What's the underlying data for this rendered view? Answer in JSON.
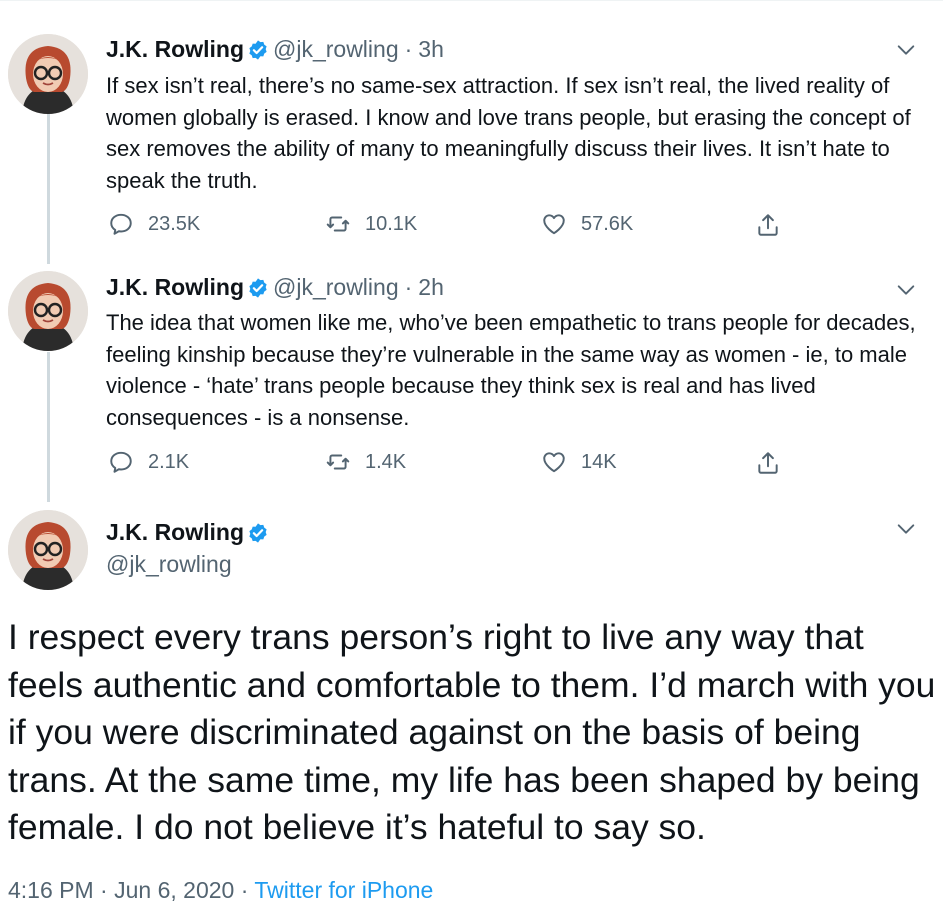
{
  "author": {
    "name": "J.K. Rowling",
    "handle": "@jk_rowling",
    "verified": true
  },
  "colors": {
    "accent": "#1d9bf0",
    "text": "#0f1419",
    "muted": "#536471",
    "thread_line": "#cfd9de"
  },
  "tweets": [
    {
      "time": "3h",
      "dot": "·",
      "text": "If sex isn’t real, there’s no same-sex attraction. If sex isn’t real, the lived reality of women globally is erased. I know and love trans people, but erasing the concept of sex removes the ability of many to meaningfully discuss their lives. It isn’t hate to speak the truth.",
      "replies": "23.5K",
      "retweets": "10.1K",
      "likes": "57.6K"
    },
    {
      "time": "2h",
      "dot": "·",
      "text": "The idea that women like me, who’ve been empathetic to trans people for decades, feeling kinship because they’re vulnerable in the same way as women - ie, to male violence - ‘hate’ trans people because they think sex is real and has lived consequences - is a nonsense.",
      "replies": "2.1K",
      "retweets": "1.4K",
      "likes": "14K"
    }
  ],
  "main_tweet": {
    "text": "I respect every trans person’s right to live any way that feels authentic and comfortable to them. I’d march with you if you were discriminated against on the basis of being trans. At the same time, my life has been shaped by being female. I do not believe it’s hateful to say so.",
    "time": "4:16 PM",
    "separator": "·",
    "date": "Jun 6, 2020",
    "source": "Twitter for iPhone"
  },
  "icons": {
    "reply": "reply-icon",
    "retweet": "retweet-icon",
    "like": "heart-icon",
    "share": "share-icon",
    "more": "chevron-down-icon",
    "verified": "verified-badge-icon"
  }
}
